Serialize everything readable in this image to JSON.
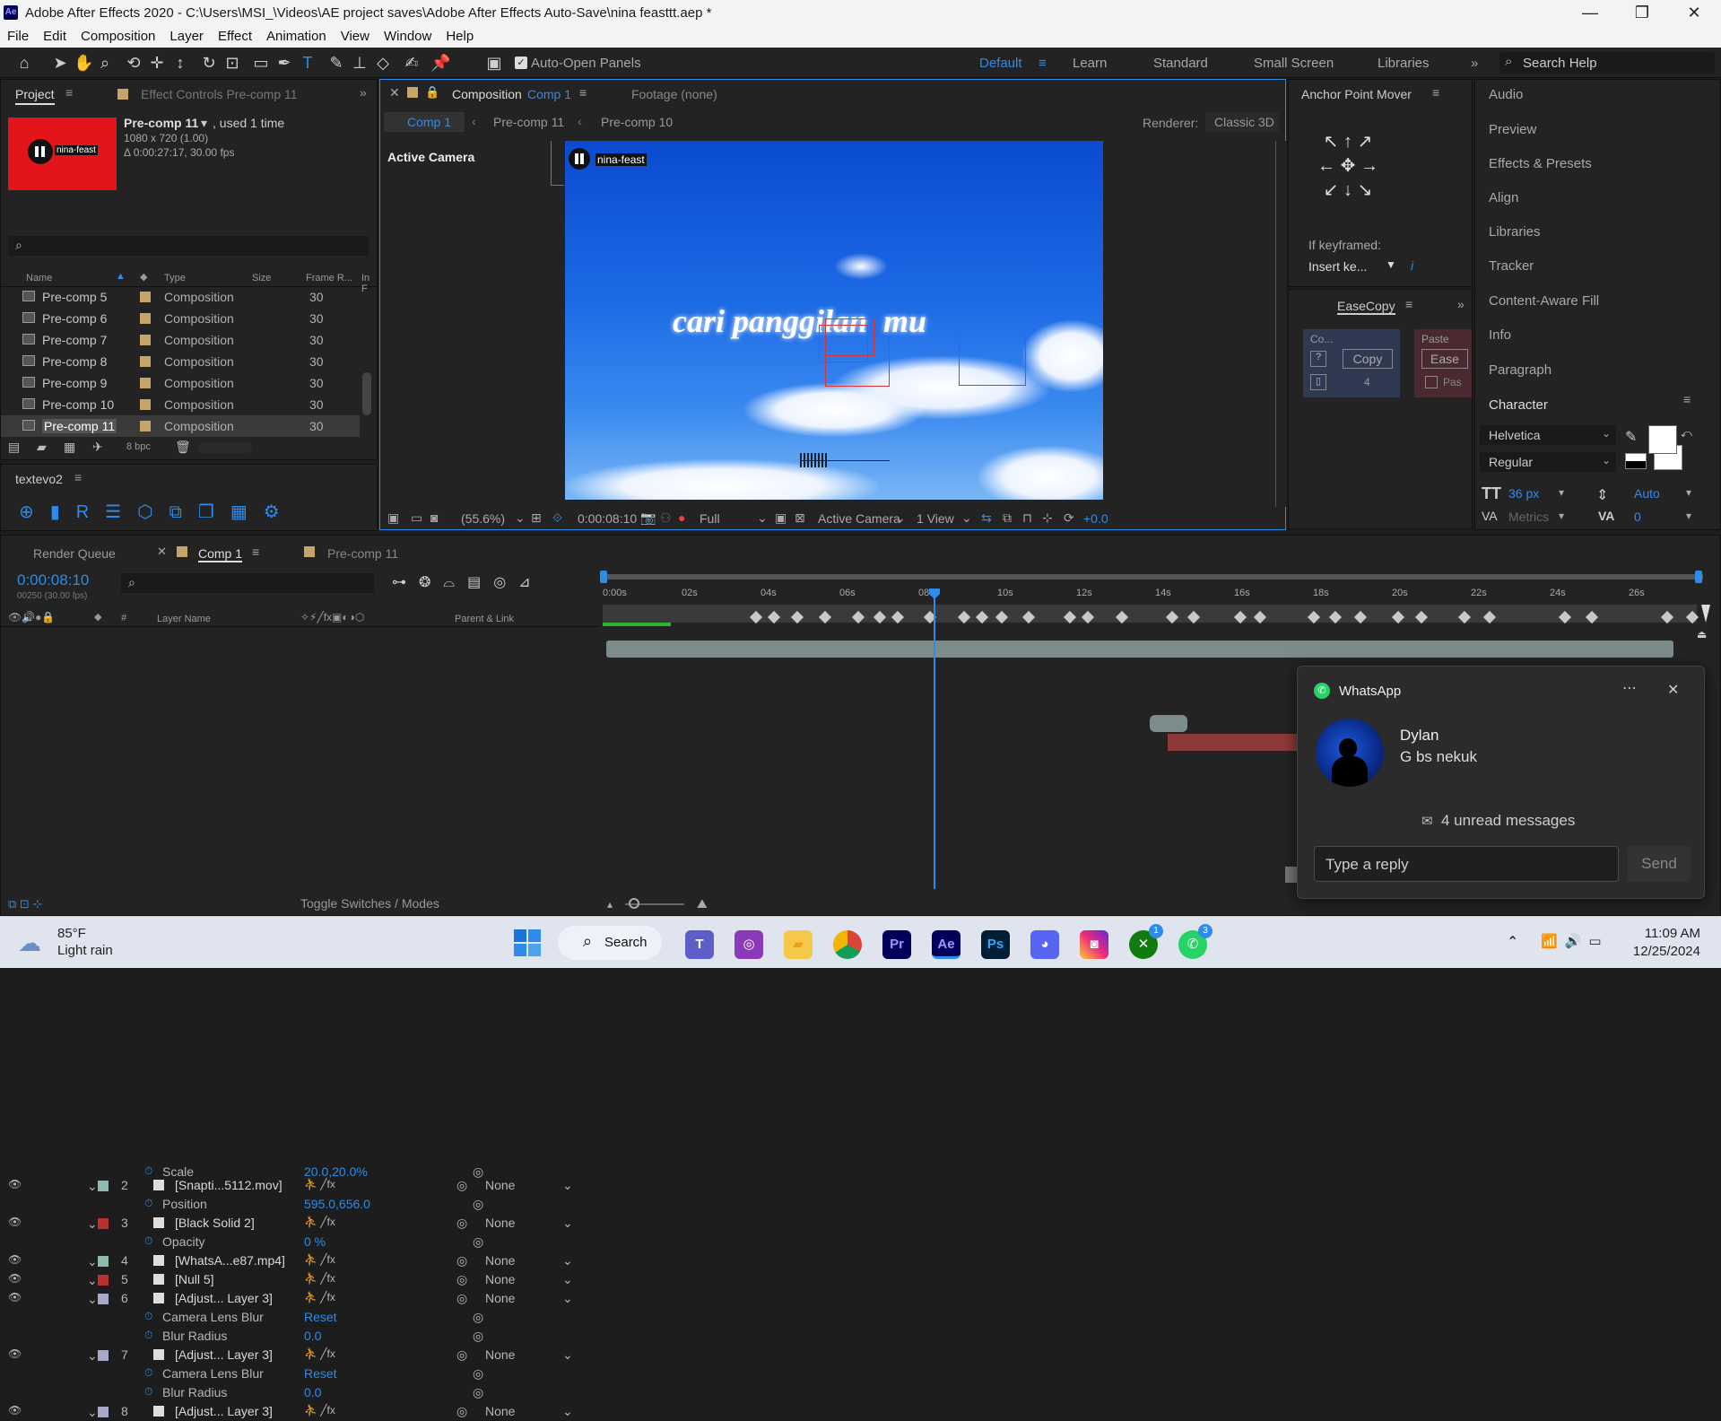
{
  "window": {
    "title": "Adobe After Effects 2020 - C:\\Users\\MSI_\\Videos\\AE project saves\\Adobe After Effects Auto-Save\\nina feasttt.aep *",
    "minimize": "—",
    "maximize": "❐",
    "close": "✕"
  },
  "menu": [
    "File",
    "Edit",
    "Composition",
    "Layer",
    "Effect",
    "Animation",
    "View",
    "Window",
    "Help"
  ],
  "toolbar": {
    "auto_open": "Auto-Open Panels",
    "workspaces": [
      "Default",
      "Learn",
      "Standard",
      "Small Screen",
      "Libraries"
    ],
    "search_placeholder": "Search Help"
  },
  "project": {
    "tab": "Project",
    "effect_tab": "Effect Controls Pre-comp 11",
    "selected_name": "Pre-comp 11",
    "used": ", used 1 time",
    "dims": "1080 x 720 (1.00)",
    "duration": "Δ 0:00:27:17, 30.00 fps",
    "thumb_label": "nina-feast",
    "columns": [
      "Name",
      "Type",
      "Size",
      "Frame R...",
      "In F"
    ],
    "items": [
      {
        "name": "Pre-comp 5",
        "type": "Composition",
        "fr": "30"
      },
      {
        "name": "Pre-comp 6",
        "type": "Composition",
        "fr": "30"
      },
      {
        "name": "Pre-comp 7",
        "type": "Composition",
        "fr": "30"
      },
      {
        "name": "Pre-comp 8",
        "type": "Composition",
        "fr": "30"
      },
      {
        "name": "Pre-comp 9",
        "type": "Composition",
        "fr": "30"
      },
      {
        "name": "Pre-comp 10",
        "type": "Composition",
        "fr": "30"
      },
      {
        "name": "Pre-comp 11",
        "type": "Composition",
        "fr": "30"
      }
    ],
    "bpc": "8 bpc"
  },
  "textevo": {
    "title": "textevo2"
  },
  "composition": {
    "tab_prefix": "Composition",
    "tab_name": "Comp 1",
    "footage": "Footage  (none)",
    "crumbs": [
      "Comp 1",
      "Pre-comp 11",
      "Pre-comp 10"
    ],
    "renderer_label": "Renderer:",
    "renderer": "Classic 3D",
    "active_camera": "Active Camera",
    "overlay_text": "cari panggilan  mu",
    "logo_text": "nina-feast",
    "zoom": "(55.6%)",
    "time": "0:00:08:10",
    "quality": "Full",
    "camera": "Active Camera",
    "views": "1 View",
    "exposure": "+0.0"
  },
  "anchor": {
    "title": "Anchor Point Mover",
    "if_key": "If keyframed:",
    "insert": "Insert ke..."
  },
  "easecopy": {
    "title": "EaseCopy",
    "copy_hdr": "Co...",
    "copy": "Copy",
    "count": "4",
    "paste_hdr": "Paste",
    "ease": "Ease",
    "pas": "Pas",
    "q": "?"
  },
  "sidebar": [
    "Audio",
    "Preview",
    "Effects & Presets",
    "Align",
    "Libraries",
    "Tracker",
    "Content-Aware Fill",
    "Info",
    "Paragraph",
    "Character"
  ],
  "character": {
    "font": "Helvetica",
    "style": "Regular",
    "size": "36 px",
    "leading": "Auto",
    "kerning": "Metrics",
    "tracking": "0"
  },
  "timeline": {
    "tabs": [
      "Render Queue",
      "Comp 1",
      "Pre-comp 11"
    ],
    "time": "0:00:08:10",
    "frames": "00250 (30.00 fps)",
    "layer_name_hdr": "Layer Name",
    "parent_hdr": "Parent & Link",
    "toggle": "Toggle Switches / Modes",
    "ticks": [
      "0:00s",
      "02s",
      "04s",
      "06s",
      "08s",
      "10s",
      "12s",
      "14s",
      "16s",
      "18s",
      "20s",
      "22s",
      "24s",
      "26s"
    ],
    "rows": [
      {
        "num": "",
        "name": "Scale",
        "value": "20.0,20.0%"
      },
      {
        "num": "2",
        "name": "[Snapti...5112.mov]",
        "parent": "None"
      },
      {
        "num": "",
        "name": "Position",
        "value": "595.0,656.0"
      },
      {
        "num": "3",
        "name": "[Black Solid 2]",
        "parent": "None"
      },
      {
        "num": "",
        "name": "Opacity",
        "value": "0 %"
      },
      {
        "num": "4",
        "name": "[WhatsA...e87.mp4]",
        "parent": "None"
      },
      {
        "num": "5",
        "name": "[Null 5]",
        "parent": "None"
      },
      {
        "num": "6",
        "name": "[Adjust... Layer 3]",
        "parent": "None"
      },
      {
        "num": "",
        "name": "Camera Lens Blur",
        "value": "Reset"
      },
      {
        "num": "",
        "name": "Blur Radius",
        "value": "0.0"
      },
      {
        "num": "7",
        "name": "[Adjust... Layer 3]",
        "parent": "None"
      },
      {
        "num": "",
        "name": "Camera Lens Blur",
        "value": "Reset"
      },
      {
        "num": "",
        "name": "Blur Radius",
        "value": "0.0"
      },
      {
        "num": "8",
        "name": "[Adjust... Layer 3]",
        "parent": "None"
      }
    ]
  },
  "whatsapp": {
    "app": "WhatsApp",
    "sender": "Dylan",
    "message": "G bs nekuk",
    "unread": "4 unread messages",
    "placeholder": "Type a reply",
    "send": "Send"
  },
  "taskbar": {
    "temp": "85°F",
    "weather": "Light rain",
    "search": "Search",
    "time": "11:09 AM",
    "date": "12/25/2024",
    "badge1": "1",
    "badge2": "3"
  }
}
